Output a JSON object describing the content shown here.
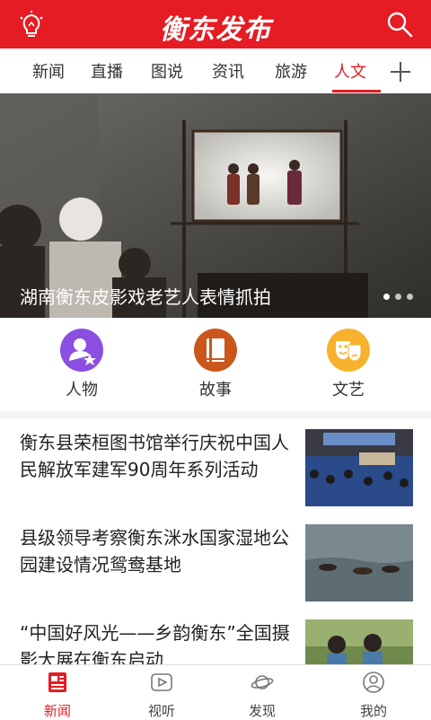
{
  "header": {
    "logo_text": "衡东发布",
    "bg_color": "#e51c23",
    "left_icon": "lightbulb-icon",
    "right_icon": "search-icon"
  },
  "tabs": [
    {
      "label": "新闻",
      "active": false
    },
    {
      "label": "直播",
      "active": false
    },
    {
      "label": "图说",
      "active": false
    },
    {
      "label": "资讯",
      "active": false
    },
    {
      "label": "旅游",
      "active": false
    },
    {
      "label": "人文",
      "active": true
    }
  ],
  "tabs_more_icon": "plus-icon",
  "banner": {
    "caption": "湖南衡东皮影戏老艺人表情抓拍",
    "slide_count": 3,
    "active_slide": 1
  },
  "categories": [
    {
      "label": "人物",
      "icon": "person-star-icon",
      "color": "#8a4fe0"
    },
    {
      "label": "故事",
      "icon": "book-icon",
      "color": "#c9571c"
    },
    {
      "label": "文艺",
      "icon": "theater-masks-icon",
      "color": "#f6b22c"
    }
  ],
  "news": [
    {
      "title": "衡东县荣桓图书馆举行庆祝中国人民解放军建军90周年系列活动",
      "thumb": "auditorium-photo"
    },
    {
      "title": "县级领导考察衡东洣水国家湿地公园建设情况鸳鸯基地",
      "thumb": "ducks-on-water-photo"
    },
    {
      "title": "“中国好风光——乡韵衡东”全国摄影大展在衡东启动",
      "thumb": "students-photo"
    }
  ],
  "bottom_nav": [
    {
      "label": "新闻",
      "icon": "news-icon",
      "active": true
    },
    {
      "label": "视听",
      "icon": "play-icon",
      "active": false
    },
    {
      "label": "发现",
      "icon": "planet-icon",
      "active": false
    },
    {
      "label": "我的",
      "icon": "user-icon",
      "active": false
    }
  ]
}
